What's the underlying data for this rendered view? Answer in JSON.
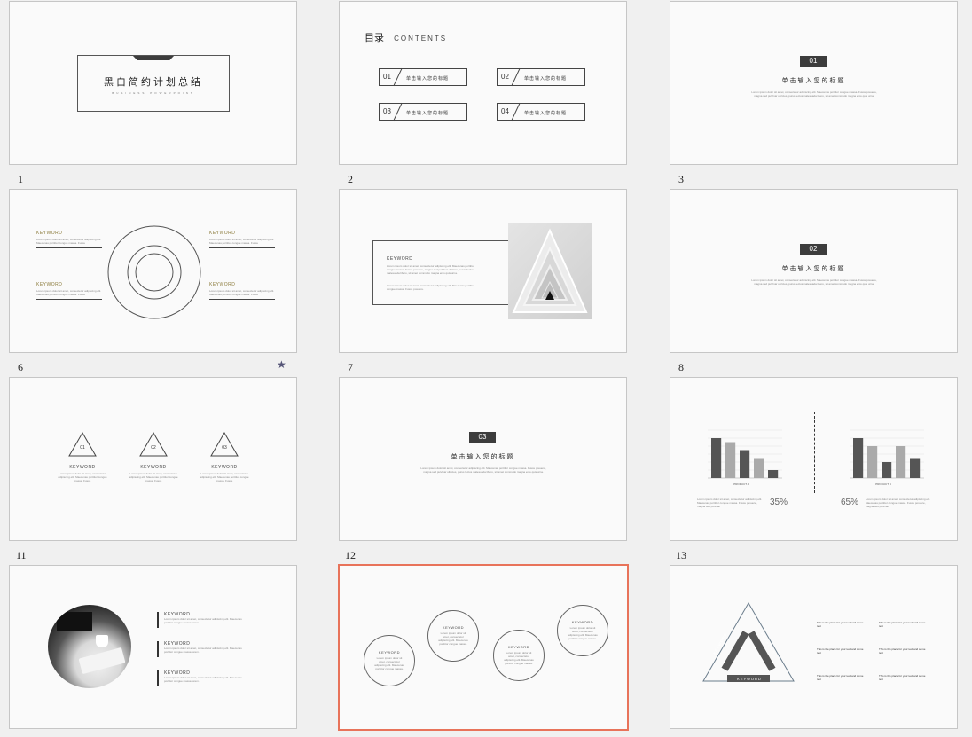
{
  "slides": [
    {
      "number": "1",
      "title": "黑白简约计划总结",
      "subtitle": "BUSINESS POWERPOINT"
    },
    {
      "number": "2",
      "heading": "目录",
      "heading_en": "CONTENTS",
      "items": [
        {
          "num": "01",
          "label": "单击输入您的标题"
        },
        {
          "num": "02",
          "label": "单击输入您的标题"
        },
        {
          "num": "03",
          "label": "单击输入您的标题"
        },
        {
          "num": "04",
          "label": "单击输入您的标题"
        }
      ]
    },
    {
      "number": "3",
      "badge": "01",
      "title": "单击输入您的标题",
      "body": "Lorem ipsum dolor sit amet, consectetur adipiscing elit. Maecenas porttitor congue massa. Fusce posuere, magna sed pulvinar ultricies, purus lectus malesuada libero, sit amet commodo magna eros quis urna."
    },
    {
      "number": "6",
      "keyword": "KEYWORD",
      "body": "Lorem ipsum dolor sit amet, consectetur adipiscing elit. Maecenas porttitor congue massa. Fusce"
    },
    {
      "number": "7",
      "keyword": "KEYWORD",
      "body": "Lorem ipsum dolor sit amet, consectetur adipiscing elit. Maecenas porttitor congue massa. Fusce posuere, magna sed pulvinar ultricies, purus lectus malesuada libero, sit amet commodo magna eros quis urna.",
      "body2": "Lorem ipsum dolor sit amet, consectetur adipiscing elit. Maecenas porttitor congue massa. Fusce posuere."
    },
    {
      "number": "8",
      "badge": "02",
      "title": "单击输入您的标题",
      "body": "Lorem ipsum dolor sit amet, consectetur adipiscing elit. Maecenas porttitor congue massa. Fusce posuere, magna sed pulvinar ultricies, purus lectus malesuada libero, sit amet commodo magna eros quis urna."
    },
    {
      "number": "11",
      "items": [
        {
          "num": "01",
          "keyword": "KEYWORD"
        },
        {
          "num": "02",
          "keyword": "KEYWORD"
        },
        {
          "num": "03",
          "keyword": "KEYWORD"
        }
      ],
      "body": "Lorem ipsum dolor sit amet, consectetur adipiscing elit. Maecenas porttitor congue massa. Fusce"
    },
    {
      "number": "12",
      "badge": "03",
      "title": "单击输入您的标题",
      "body": "Lorem ipsum dolor sit amet, consectetur adipiscing elit. Maecenas porttitor congue massa. Fusce posuere, magna sed pulvinar ultricies, purus lectus malesuada libero, sit amet commodo magna eros quis urna."
    },
    {
      "number": "13",
      "pct_right": "35%",
      "pct_left": "65%",
      "body": "Lorem ipsum dolor sit amet, consectetur adipiscing elit. Maecenas porttitor congue massa. Fusce posuere, magna sed pulvinar"
    },
    {
      "number": "",
      "keyword": "KEYWORD",
      "body": "Lorem ipsum dolor sit amet, consectetur adipiscing elit. Maecenas porttitor congue massa lorem."
    },
    {
      "number": "",
      "keyword": "KEYWORD",
      "body": "Lorem ipsum dolor sit amet, consectetur adipiscing elit. Maecenas porttitor congue massa."
    },
    {
      "number": "",
      "keyword": "KEYWORD",
      "body": "This is the place for your text and some text"
    }
  ],
  "colors": {
    "dark": "#3c3c3c",
    "bar_dark": "#555555",
    "bar_light": "#aaaaaa",
    "selection": "#e8735a",
    "star": "#555577"
  },
  "icons": {
    "slide6_marker": "star-icon"
  },
  "star_glyph": "★",
  "chart_data": [
    {
      "type": "bar",
      "values": [
        1.0,
        0.9,
        0.7,
        0.5,
        0.2
      ],
      "ylim": [
        0,
        1.2
      ],
      "xlabel": "PRODUCT A"
    },
    {
      "type": "bar",
      "values": [
        1.0,
        0.8,
        0.4,
        0.8,
        0.5
      ],
      "ylim": [
        0,
        1.2
      ],
      "xlabel": "PRODUCT B"
    }
  ]
}
